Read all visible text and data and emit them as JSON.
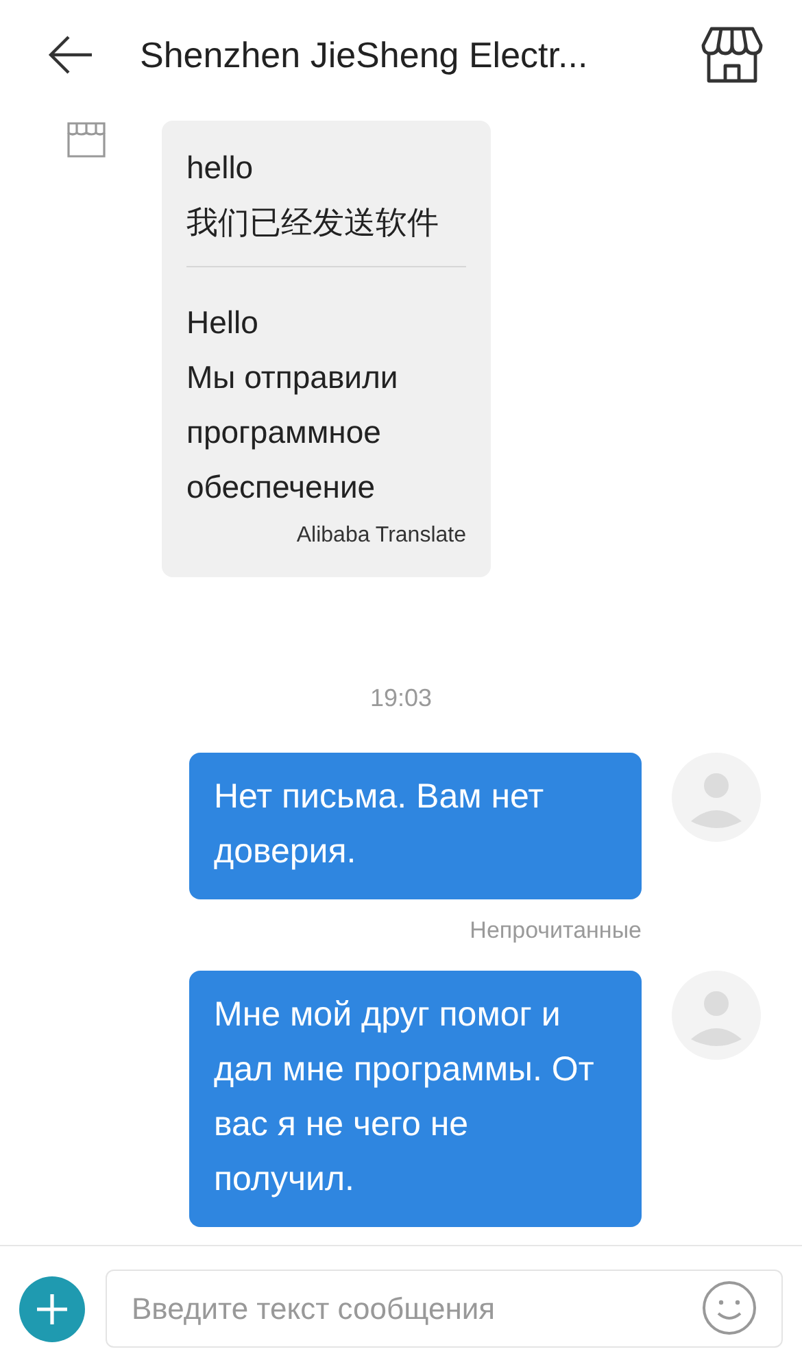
{
  "header": {
    "title": "Shenzhen JieSheng Electr..."
  },
  "messages": [
    {
      "kind": "received",
      "original": [
        "hello",
        "我们已经发送软件"
      ],
      "translation": [
        "Hello",
        "Мы отправили программное обеспечение"
      ],
      "translator": "Alibaba Translate"
    },
    {
      "kind": "time",
      "text": "19:03"
    },
    {
      "kind": "sent",
      "text": "Нет письма. Вам нет доверия.",
      "status": "Непрочитанные"
    },
    {
      "kind": "sent",
      "text": "Мне мой друг помог и дал мне программы. От вас я не чего не получил."
    }
  ],
  "composer": {
    "placeholder": "Введите текст сообщения"
  }
}
